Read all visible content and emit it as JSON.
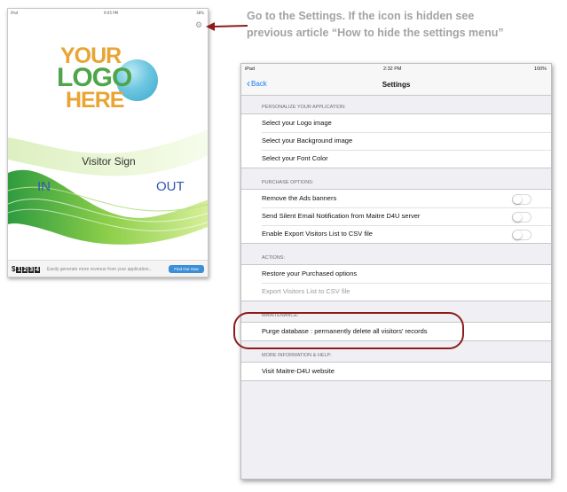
{
  "left_screen": {
    "status": {
      "carrier": "iPad",
      "time": "9:05 PM",
      "battery": "38%"
    },
    "logo": {
      "line1": "YOUR",
      "line2": "LOGO",
      "line3": "HERE"
    },
    "title": "Visitor Sign",
    "in_label": "IN",
    "out_label": "OUT",
    "ad": {
      "brand_prefix": "$",
      "brand_digits": [
        "1",
        "2",
        "3",
        "4"
      ],
      "text": "Easily generate more revenue from your application...",
      "button": "Find Out How"
    }
  },
  "callout": {
    "line1": "Go to the Settings. If the icon is hidden see",
    "line2": "previous article “How to hide the settings menu”",
    "color": "#a3a3a3",
    "arrow_color": "#8e1b1b"
  },
  "settings": {
    "status": {
      "carrier": "iPad",
      "time": "2:32 PM",
      "battery": "100%"
    },
    "back_label": "Back",
    "title": "Settings",
    "sections": [
      {
        "header": "PERSONALIZE YOUR APPLICATION:",
        "rows": [
          {
            "label": "Select your Logo image"
          },
          {
            "label": "Select your Background image"
          },
          {
            "label": "Select your Font Color"
          }
        ]
      },
      {
        "header": "PURCHASE OPTIONS:",
        "rows": [
          {
            "label": "Remove the Ads banners",
            "toggle": false
          },
          {
            "label": "Send Silent Email Notification from Maitre D4U server",
            "toggle": false
          },
          {
            "label": "Enable Export Visitors List to CSV file",
            "toggle": false
          }
        ]
      },
      {
        "header": "ACTIONS:",
        "rows": [
          {
            "label": "Restore your Purchased options"
          },
          {
            "label": "Export Visitors List to CSV file",
            "disabled": true
          }
        ]
      },
      {
        "header": "MAINTENANCE:",
        "rows": [
          {
            "label": "Purge database : permanently delete all visitors' records"
          }
        ]
      },
      {
        "header": "MORE INFORMATION & HELP:",
        "rows": [
          {
            "label": "Visit Maitre-D4U website"
          }
        ]
      }
    ],
    "accent_color": "#1a7cf2",
    "highlight_color": "#8e1b1b"
  }
}
